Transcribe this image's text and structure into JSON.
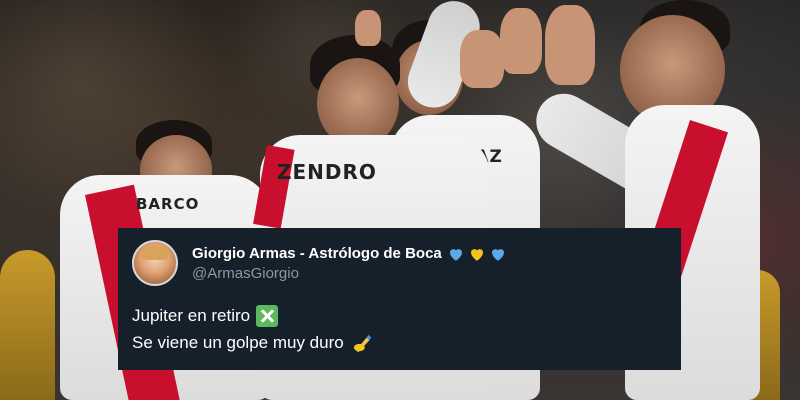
{
  "photo": {
    "jersey_names": [
      "BARCO",
      "ZENDRO",
      "NZO DIAZ"
    ],
    "colors": {
      "jersey": "#f2f2f2",
      "sash": "#c8102e",
      "background": "#2a2a2a"
    }
  },
  "tweet": {
    "display_name": "Giorgio Armas - Astrólogo de Boca",
    "handle": "@ArmasGiorgio",
    "hearts": [
      "blue-heart",
      "yellow-heart",
      "blue-heart"
    ],
    "lines": [
      {
        "text": "Jupiter en retiro",
        "emoji": "cross-mark-icon"
      },
      {
        "text": "Se viene un golpe muy duro",
        "emoji": "writing-hand-icon"
      }
    ],
    "colors": {
      "background": "#15202b",
      "text": "#ffffff",
      "handle": "#8b98a5",
      "blue_heart": "#5fa8e8",
      "yellow_heart": "#f5c518"
    }
  }
}
